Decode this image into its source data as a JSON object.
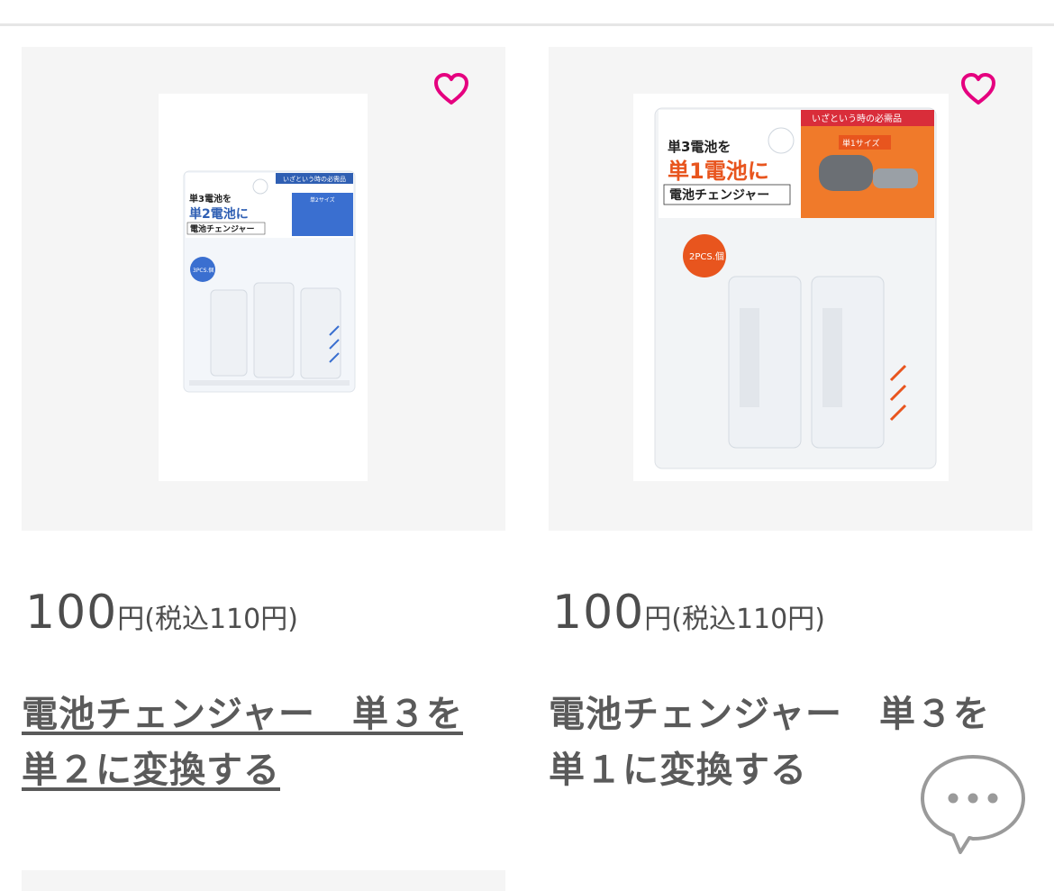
{
  "products": [
    {
      "price_amount": "100",
      "price_currency": "円",
      "price_tax": "(税込110円)",
      "title_line1": "電池チェンジャー　単３を",
      "title_line2": "単２に変換する",
      "package": {
        "tag": "いざという時の必需品",
        "line1": "単3電池を",
        "line2": "単2電池に",
        "line3": "電池チェンジャー",
        "badge": "3PCS.個",
        "size": "単2サイズ"
      }
    },
    {
      "price_amount": "100",
      "price_currency": "円",
      "price_tax": "(税込110円)",
      "title_line1": "電池チェンジャー　単３を",
      "title_line2": "単１に変換する",
      "package": {
        "tag": "いざという時の必需品",
        "line1": "単3電池を",
        "line2": "単1電池に",
        "line3": "電池チェンジャー",
        "badge": "2PCS.個",
        "size": "単1サイズ"
      }
    }
  ],
  "colors": {
    "heart": "#e5007f",
    "accent_blue": "#2f5fb3",
    "accent_orange": "#e8551e"
  },
  "icons": {
    "favorite": "heart-outline-icon",
    "chat": "chat-bubble-icon"
  }
}
